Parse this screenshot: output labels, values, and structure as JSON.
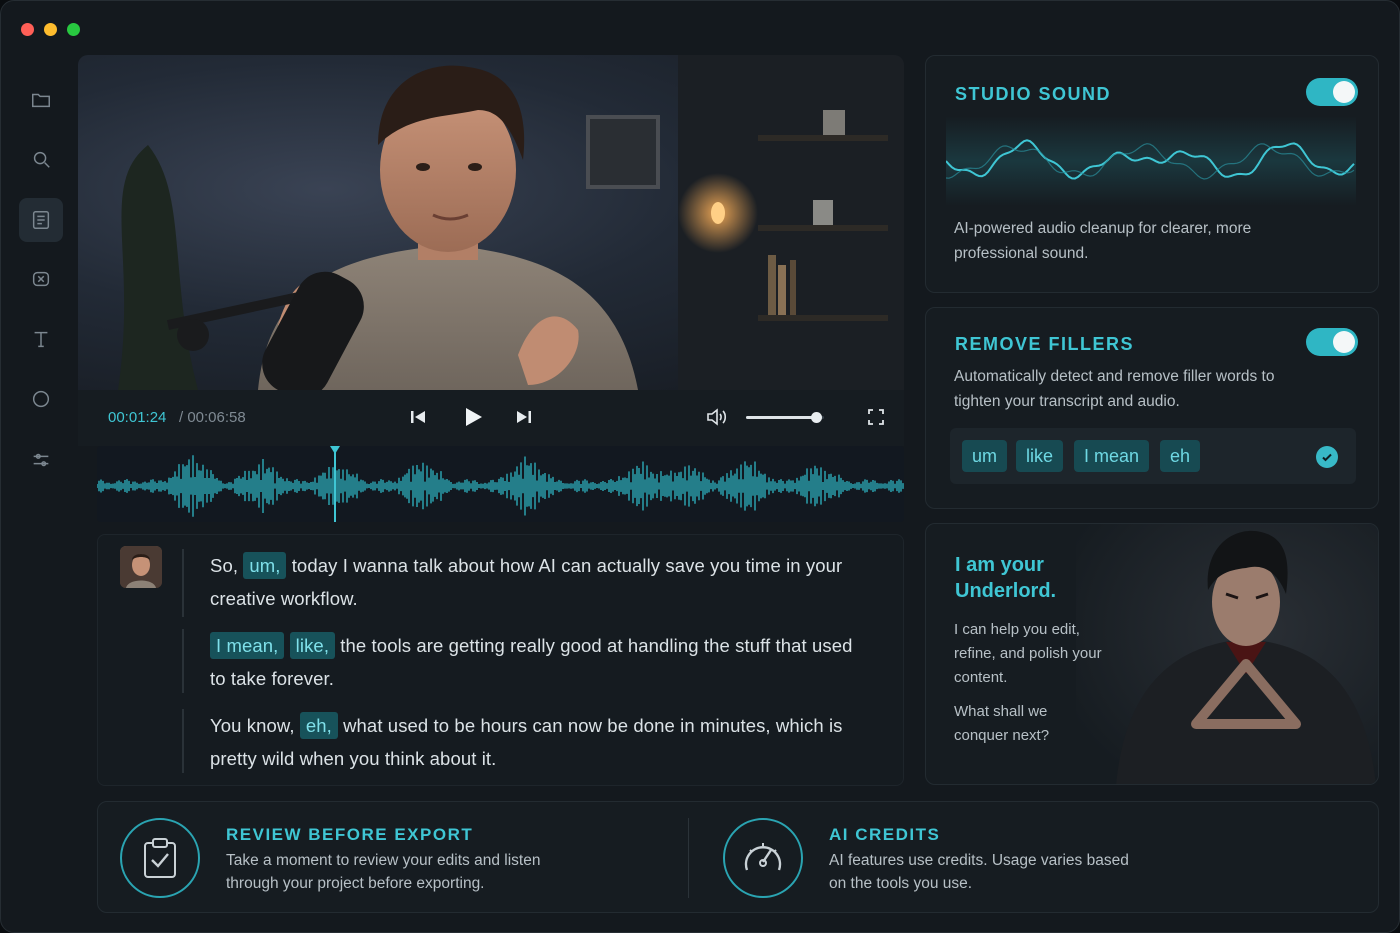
{
  "window": {
    "traffic_lights": [
      "close",
      "minimize",
      "zoom"
    ]
  },
  "sidebar": {
    "items": [
      {
        "icon": "folder-icon",
        "active": false
      },
      {
        "icon": "search-icon",
        "active": false
      },
      {
        "icon": "transcript-icon",
        "active": true
      },
      {
        "icon": "media-icon",
        "active": false
      },
      {
        "icon": "text-icon",
        "active": false
      },
      {
        "icon": "shape-icon",
        "active": false
      },
      {
        "icon": "adjust-icon",
        "active": false
      }
    ]
  },
  "player": {
    "current_time": "00:01:24",
    "total_time": "/ 00:06:58",
    "volume": 0.9,
    "playhead_progress": 0.2
  },
  "transcript": {
    "paragraphs": [
      {
        "segments": [
          {
            "text": "So, ",
            "filler": false
          },
          {
            "text": "um,",
            "filler": true
          },
          {
            "text": " today I wanna talk about how AI can actually save you time in your creative workflow.",
            "filler": false
          }
        ]
      },
      {
        "segments": [
          {
            "text": "I mean,",
            "filler": true
          },
          {
            "text": " ",
            "filler": false
          },
          {
            "text": "like,",
            "filler": true
          },
          {
            "text": " the tools are getting really good at handling the stuff that used to take forever.",
            "filler": false
          }
        ]
      },
      {
        "segments": [
          {
            "text": "You know, ",
            "filler": false
          },
          {
            "text": "eh,",
            "filler": true
          },
          {
            "text": " what used to be hours can now be done in minutes, which is pretty wild when you think about it.",
            "filler": false
          }
        ]
      }
    ]
  },
  "studio_sound": {
    "title": "STUDIO SOUND",
    "enabled": true,
    "description": "AI-powered audio cleanup for clearer, more professional sound."
  },
  "remove_fillers": {
    "title": "REMOVE FILLERS",
    "enabled": true,
    "description": "Automatically detect and remove filler words to tighten your transcript and audio.",
    "words": [
      "um",
      "like",
      "I mean",
      "eh"
    ]
  },
  "underlord": {
    "title_line1": "I am your",
    "title_line2": "Underlord.",
    "text1": "I can help you edit, refine, and polish your content.",
    "text2": "What shall we conquer next?"
  },
  "review": {
    "title": "REVIEW BEFORE EXPORT",
    "text": "Take a moment to review your edits and listen through your project before exporting."
  },
  "credits": {
    "title": "AI CREDITS",
    "text": "AI features use credits. Usage varies based on the tools you use."
  },
  "colors": {
    "accent": "#3fc6d4",
    "background": "#14191e",
    "panel": "#161c21"
  }
}
